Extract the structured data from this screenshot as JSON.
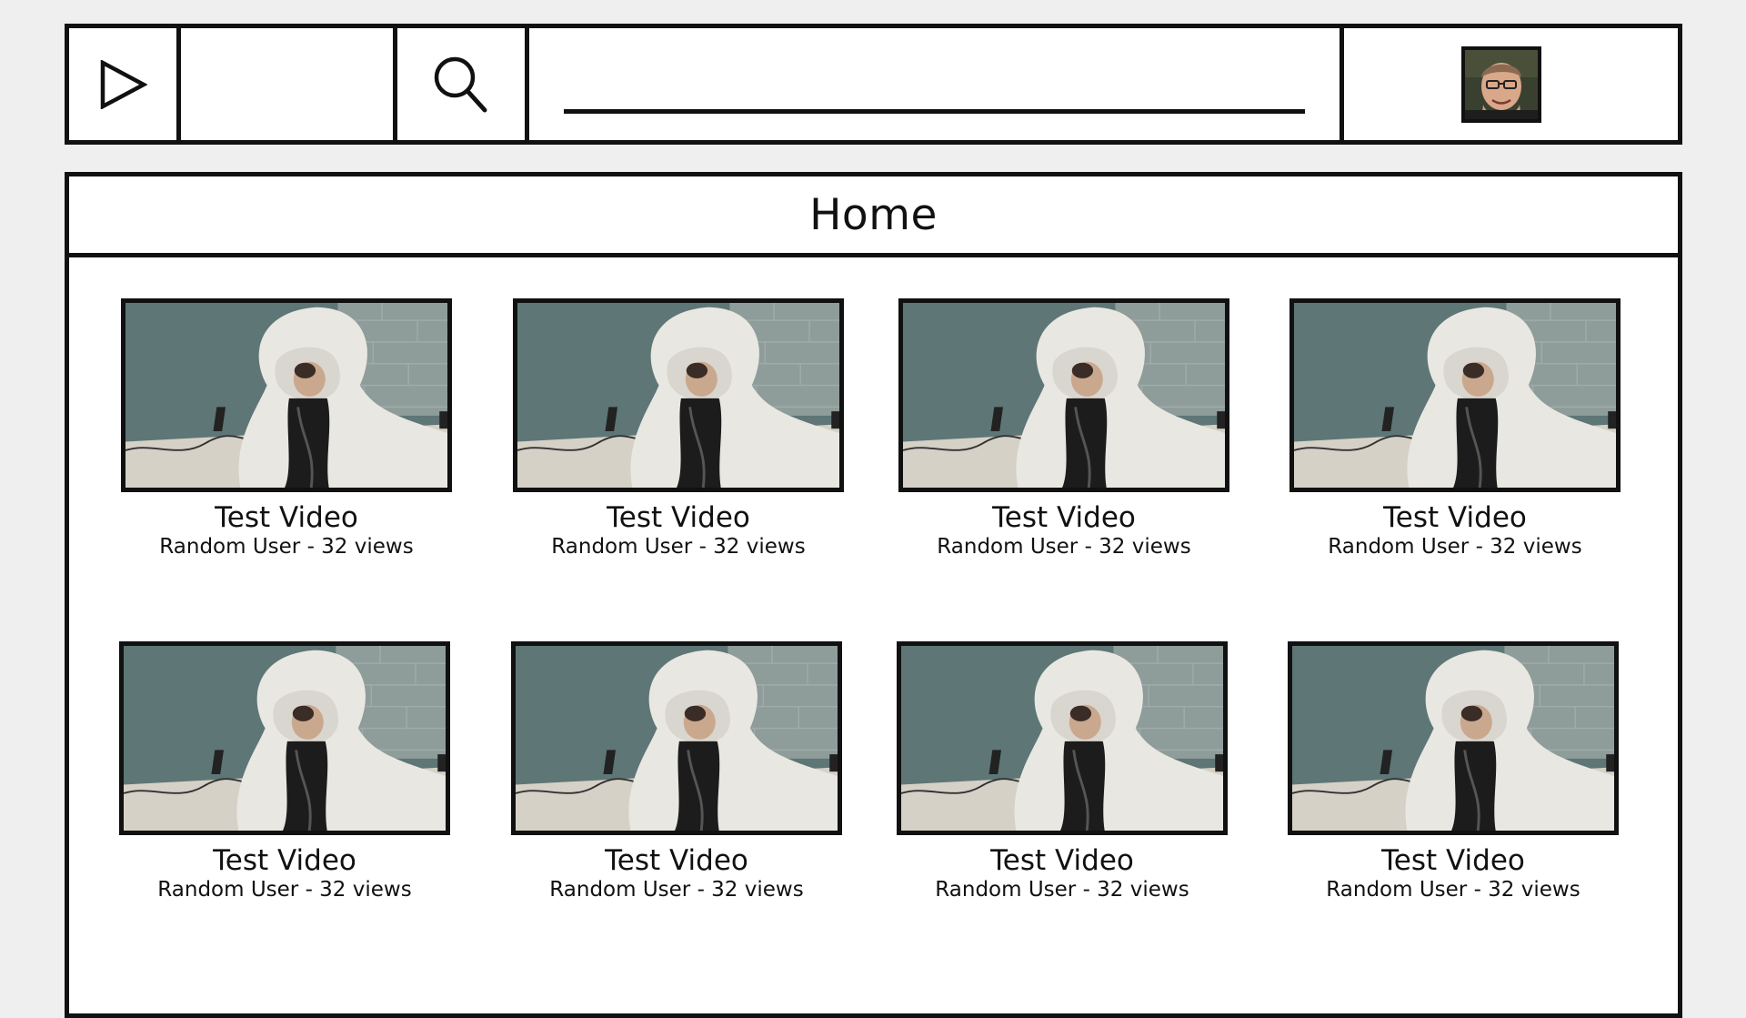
{
  "toolbar": {
    "play_icon": "play-icon",
    "search_icon": "search-icon",
    "search_value": "",
    "search_placeholder": "",
    "avatar_icon": "user-avatar"
  },
  "page": {
    "title": "Home"
  },
  "videos": [
    {
      "title": "Test Video",
      "meta": "Random User - 32 views"
    },
    {
      "title": "Test Video",
      "meta": "Random User - 32 views"
    },
    {
      "title": "Test Video",
      "meta": "Random User - 32 views"
    },
    {
      "title": "Test Video",
      "meta": "Random User - 32 views"
    },
    {
      "title": "Test Video",
      "meta": "Random User - 32 views"
    },
    {
      "title": "Test Video",
      "meta": "Random User - 32 views"
    },
    {
      "title": "Test Video",
      "meta": "Random User - 32 views"
    },
    {
      "title": "Test Video",
      "meta": "Random User - 32 views"
    }
  ],
  "colors": {
    "border": "#111111",
    "background": "#efefef",
    "panel": "#ffffff"
  }
}
